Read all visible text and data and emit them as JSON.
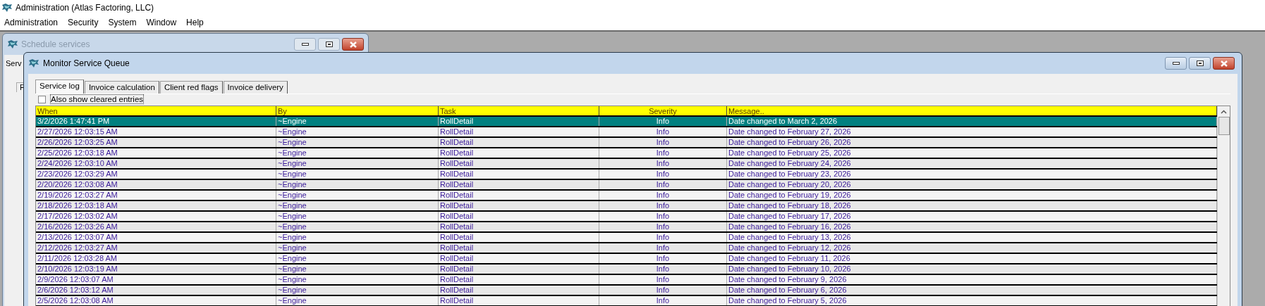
{
  "app": {
    "title": "Administration (Atlas Factoring, LLC)"
  },
  "menu": [
    "Administration",
    "Security",
    "System",
    "Window",
    "Help"
  ],
  "background_window": {
    "title": "Schedule services",
    "texts": [
      "Serv",
      "F"
    ]
  },
  "window": {
    "title": "Monitor Service Queue"
  },
  "tabs": [
    {
      "label": "Service log",
      "selected": true
    },
    {
      "label": "Invoice calculation",
      "selected": false
    },
    {
      "label": "Client red flags",
      "selected": false
    },
    {
      "label": "Invoice delivery",
      "selected": false
    }
  ],
  "show_cleared": {
    "label": "Also show cleared entries",
    "checked": false
  },
  "table": {
    "columns": [
      {
        "label": "When"
      },
      {
        "label": "By"
      },
      {
        "label": "Task"
      },
      {
        "label": "Severity"
      },
      {
        "label": "Message.."
      }
    ],
    "rows": [
      {
        "selected": true,
        "cells": [
          "3/2/2026 1:47:41 PM",
          "~Engine",
          "RollDetail",
          "Info",
          "Date changed to March 2, 2026"
        ]
      },
      {
        "selected": false,
        "cells": [
          "2/27/2026 12:03:15 AM",
          "~Engine",
          "RollDetail",
          "Info",
          "Date changed to February 27, 2026"
        ]
      },
      {
        "selected": false,
        "cells": [
          "2/26/2026 12:03:25 AM",
          "~Engine",
          "RollDetail",
          "Info",
          "Date changed to February 26, 2026"
        ]
      },
      {
        "selected": false,
        "cells": [
          "2/25/2026 12:03:18 AM",
          "~Engine",
          "RollDetail",
          "Info",
          "Date changed to February 25, 2026"
        ]
      },
      {
        "selected": false,
        "cells": [
          "2/24/2026 12:03:10 AM",
          "~Engine",
          "RollDetail",
          "Info",
          "Date changed to February 24, 2026"
        ]
      },
      {
        "selected": false,
        "cells": [
          "2/23/2026 12:03:29 AM",
          "~Engine",
          "RollDetail",
          "Info",
          "Date changed to February 23, 2026"
        ]
      },
      {
        "selected": false,
        "cells": [
          "2/20/2026 12:03:08 AM",
          "~Engine",
          "RollDetail",
          "Info",
          "Date changed to February 20, 2026"
        ]
      },
      {
        "selected": false,
        "cells": [
          "2/19/2026 12:03:27 AM",
          "~Engine",
          "RollDetail",
          "Info",
          "Date changed to February 19, 2026"
        ]
      },
      {
        "selected": false,
        "cells": [
          "2/18/2026 12:03:18 AM",
          "~Engine",
          "RollDetail",
          "Info",
          "Date changed to February 18, 2026"
        ]
      },
      {
        "selected": false,
        "cells": [
          "2/17/2026 12:03:02 AM",
          "~Engine",
          "RollDetail",
          "Info",
          "Date changed to February 17, 2026"
        ]
      },
      {
        "selected": false,
        "cells": [
          "2/16/2026 12:03:26 AM",
          "~Engine",
          "RollDetail",
          "Info",
          "Date changed to February 16, 2026"
        ]
      },
      {
        "selected": false,
        "cells": [
          "2/13/2026 12:03:07 AM",
          "~Engine",
          "RollDetail",
          "Info",
          "Date changed to February 13, 2026"
        ]
      },
      {
        "selected": false,
        "cells": [
          "2/12/2026 12:03:27 AM",
          "~Engine",
          "RollDetail",
          "Info",
          "Date changed to February 12, 2026"
        ]
      },
      {
        "selected": false,
        "cells": [
          "2/11/2026 12:03:28 AM",
          "~Engine",
          "RollDetail",
          "Info",
          "Date changed to February 11, 2026"
        ]
      },
      {
        "selected": false,
        "cells": [
          "2/10/2026 12:03:19 AM",
          "~Engine",
          "RollDetail",
          "Info",
          "Date changed to February 10, 2026"
        ]
      },
      {
        "selected": false,
        "cells": [
          "2/9/2026 12:03:07 AM",
          "~Engine",
          "RollDetail",
          "Info",
          "Date changed to February 9, 2026"
        ]
      },
      {
        "selected": false,
        "cells": [
          "2/6/2026 12:03:12 AM",
          "~Engine",
          "RollDetail",
          "Info",
          "Date changed to February 6, 2026"
        ]
      },
      {
        "selected": false,
        "cells": [
          "2/5/2026 12:03:08 AM",
          "~Engine",
          "RollDetail",
          "Info",
          "Date changed to February 5, 2026"
        ]
      }
    ]
  }
}
